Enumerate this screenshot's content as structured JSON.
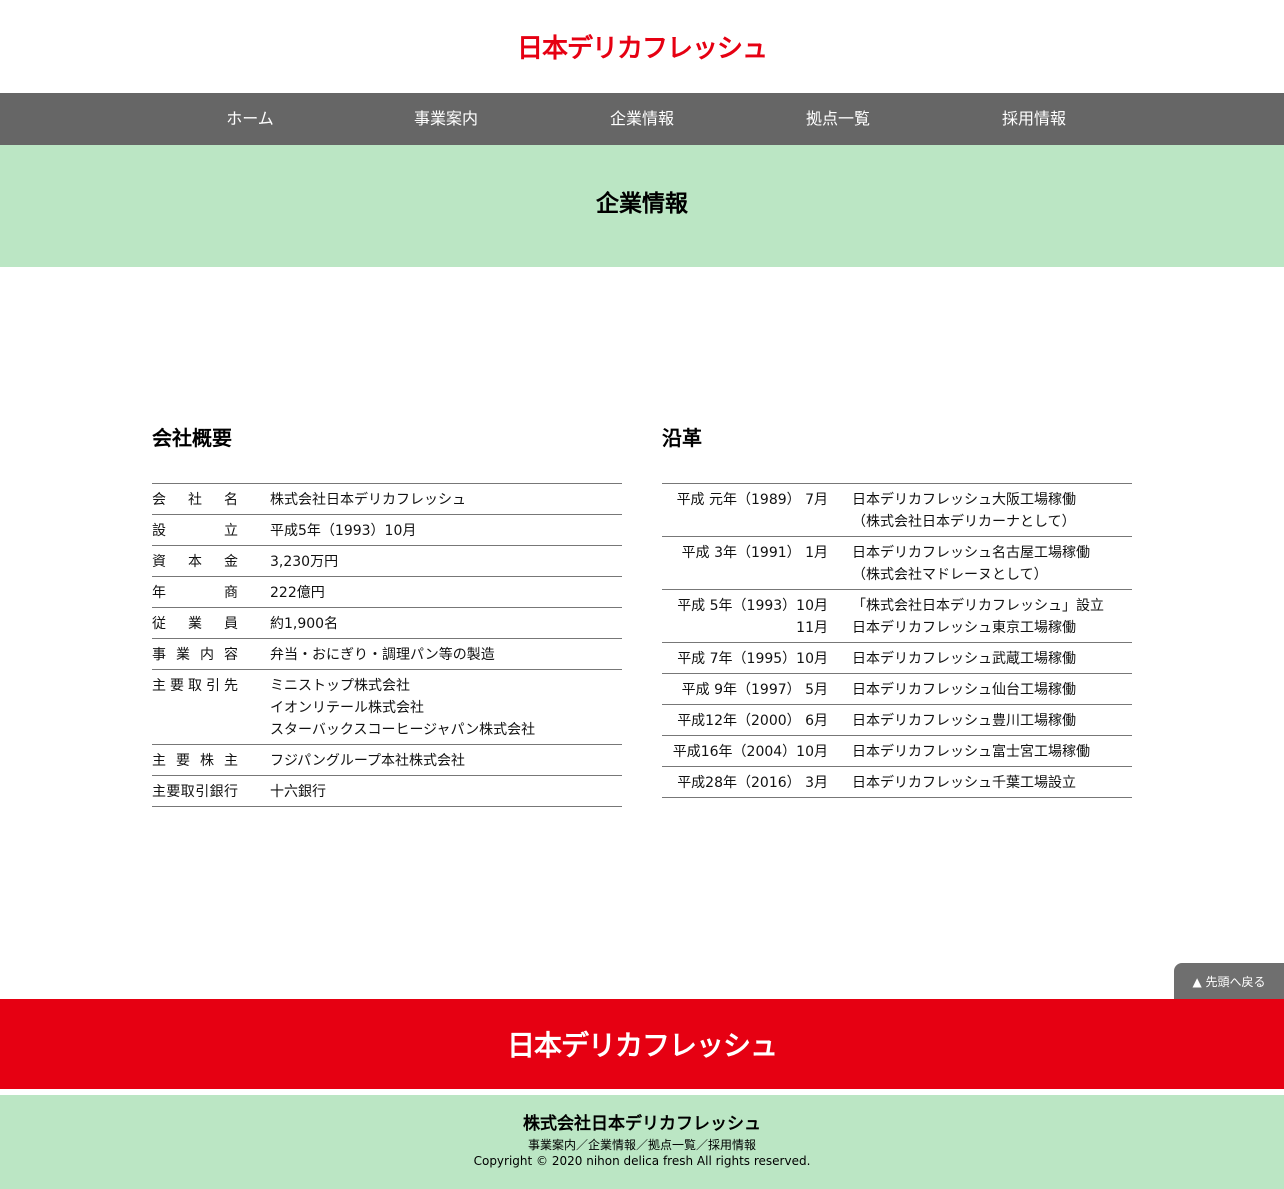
{
  "header": {
    "logo_text": "日本デリカフレッシュ"
  },
  "nav": {
    "items": [
      {
        "label": "ホーム"
      },
      {
        "label": "事業案内"
      },
      {
        "label": "企業情報"
      },
      {
        "label": "拠点一覧"
      },
      {
        "label": "採用情報"
      }
    ]
  },
  "hero": {
    "title": "企業情報"
  },
  "overview": {
    "title": "会社概要",
    "rows": [
      {
        "label": "会社名",
        "lines": [
          "株式会社日本デリカフレッシュ"
        ]
      },
      {
        "label": "設立",
        "lines": [
          "平成5年（1993）10月"
        ]
      },
      {
        "label": "資本金",
        "lines": [
          "3,230万円"
        ]
      },
      {
        "label": "年商",
        "lines": [
          "222億円"
        ]
      },
      {
        "label": "従業員",
        "lines": [
          "約1,900名"
        ]
      },
      {
        "label": "事業内容",
        "lines": [
          "弁当・おにぎり・調理パン等の製造"
        ]
      },
      {
        "label": "主要取引先",
        "lines": [
          "ミニストップ株式会社",
          "イオンリテール株式会社",
          "スターバックスコーヒージャパン株式会社"
        ]
      },
      {
        "label": "主要株主",
        "lines": [
          "フジパングループ本社株式会社"
        ]
      },
      {
        "label": "主要取引銀行",
        "lines": [
          "十六銀行"
        ]
      }
    ]
  },
  "history": {
    "title": "沿革",
    "rows": [
      {
        "dates": [
          "平成 元年（1989） 7月"
        ],
        "events": [
          "日本デリカフレッシュ大阪工場稼働",
          "（株式会社日本デリカーナとして）"
        ]
      },
      {
        "dates": [
          "平成 3年（1991） 1月"
        ],
        "events": [
          "日本デリカフレッシュ名古屋工場稼働",
          "（株式会社マドレーヌとして）"
        ]
      },
      {
        "dates": [
          "平成 5年（1993）10月",
          "11月"
        ],
        "events": [
          "「株式会社日本デリカフレッシュ」設立",
          "日本デリカフレッシュ東京工場稼働"
        ]
      },
      {
        "dates": [
          "平成 7年（1995）10月"
        ],
        "events": [
          "日本デリカフレッシュ武蔵工場稼働"
        ]
      },
      {
        "dates": [
          "平成 9年（1997） 5月"
        ],
        "events": [
          "日本デリカフレッシュ仙台工場稼働"
        ]
      },
      {
        "dates": [
          "平成12年（2000） 6月"
        ],
        "events": [
          "日本デリカフレッシュ豊川工場稼働"
        ]
      },
      {
        "dates": [
          "平成16年（2004）10月"
        ],
        "events": [
          "日本デリカフレッシュ富士宮工場稼働"
        ]
      },
      {
        "dates": [
          "平成28年（2016） 3月"
        ],
        "events": [
          "日本デリカフレッシュ千葉工場設立"
        ]
      }
    ]
  },
  "back_to_top": {
    "label": "▲ 先頭へ戻る"
  },
  "footer": {
    "logo_text": "日本デリカフレッシュ",
    "company_name": "株式会社日本デリカフレッシュ",
    "links": [
      "事業案内",
      "企業情報",
      "拠点一覧",
      "採用情報"
    ],
    "separator": "／",
    "copyright": "Copyright © 2020 nihon delica fresh All rights reserved."
  }
}
